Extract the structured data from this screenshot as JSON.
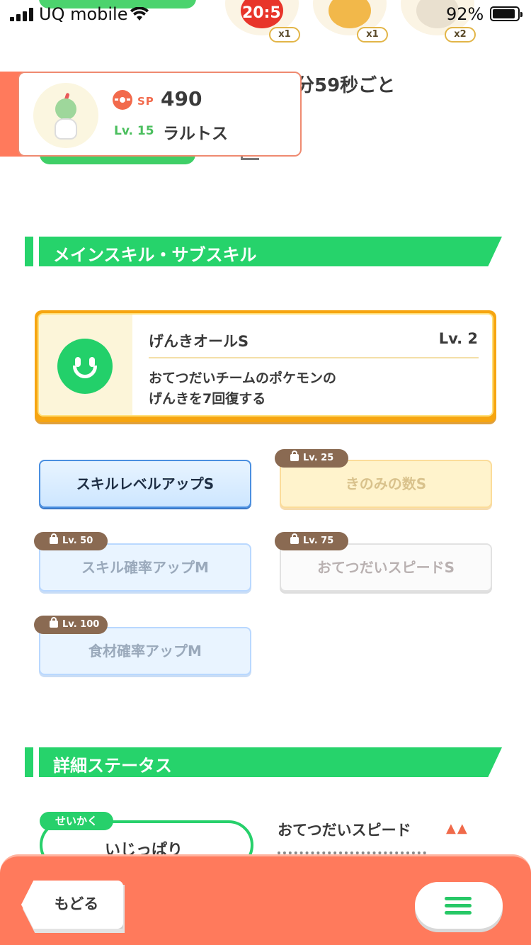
{
  "status_bar": {
    "carrier": "UQ mobile",
    "battery_percent": "92%"
  },
  "top_items": [
    {
      "icon": "apple-ingredient-icon",
      "timer": "20:5",
      "qty": "x1",
      "color": "#e8352a"
    },
    {
      "icon": "corn-ingredient-icon",
      "qty": "x1",
      "color": "#f2b84a"
    },
    {
      "icon": "leek-ingredient-icon",
      "qty": "x2",
      "color": "#c8b8a0"
    }
  ],
  "behind": {
    "help_interval_fragment": "分59秒ごと"
  },
  "pokemon": {
    "sp_label": "SP",
    "sp_value": "490",
    "level_label": "Lv. 15",
    "name": "ラルトス"
  },
  "sections": {
    "skills_title": "メインスキル・サブスキル",
    "details_title": "詳細ステータス"
  },
  "main_skill": {
    "name": "げんきオールS",
    "level": "Lv. 2",
    "desc_line1": "おてつだいチームのポケモンの",
    "desc_line2": "げんきを7回復する"
  },
  "sub_skills": [
    {
      "label": "スキルレベルアップS",
      "lock": ""
    },
    {
      "label": "きのみの数S",
      "lock": "Lv. 25"
    },
    {
      "label": "スキル確率アップM",
      "lock": "Lv. 50"
    },
    {
      "label": "おてつだいスピードS",
      "lock": "Lv. 75"
    },
    {
      "label": "食材確率アップM",
      "lock": "Lv. 100"
    }
  ],
  "details": {
    "nature_tag": "せいかく",
    "nature_value": "いじっぱり",
    "effect_label": "おてつだいスピード",
    "effect_arrows": "▲▲"
  },
  "bottom_bar": {
    "back_label": "もどる"
  },
  "colors": {
    "accent_green": "#26d36b",
    "accent_orange": "#ff7a5c",
    "skill_gold": "#f6a511"
  }
}
